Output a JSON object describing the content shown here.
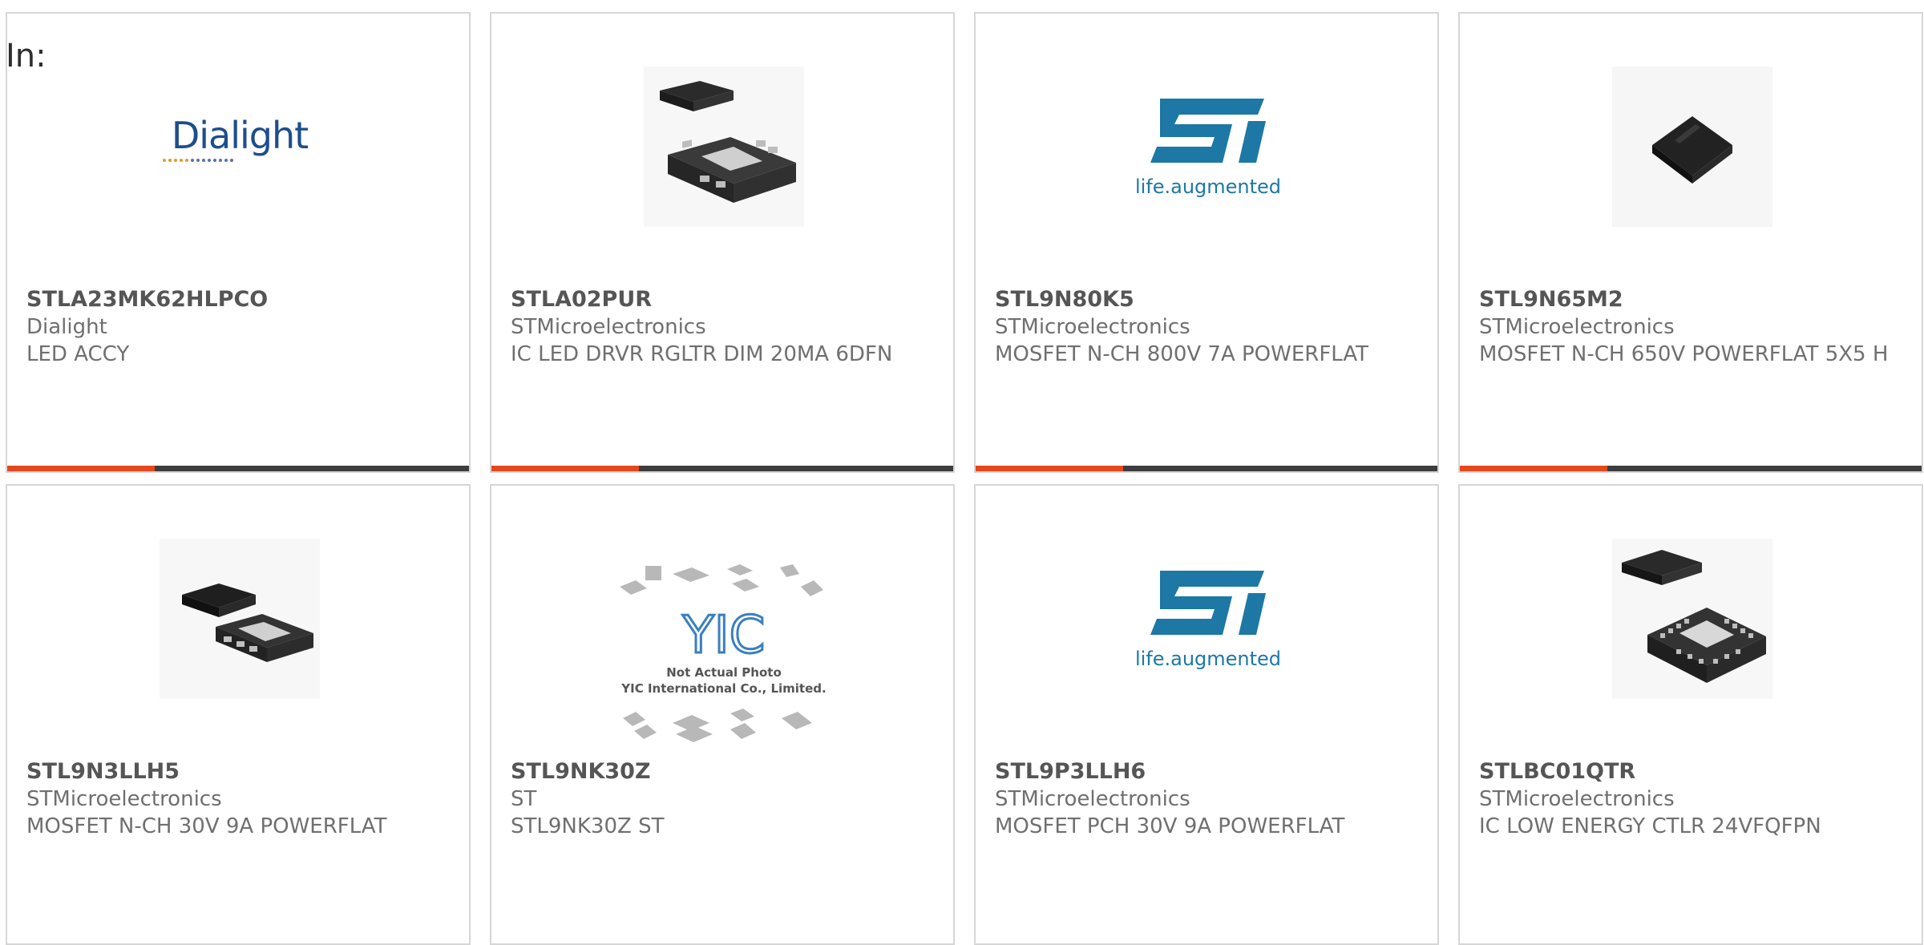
{
  "page": {
    "label": "In:"
  },
  "accent": {
    "bar_fill": "#e5481c",
    "bar_track": "#3d3d3d",
    "st_blue": "#1d78a5",
    "dialight_blue": "#1d4e8d"
  },
  "products": [
    {
      "part_number": "STLA23MK62HLPCO",
      "manufacturer": "Dialight",
      "description": "LED ACCY",
      "image_icon": "dialight-logo-icon",
      "image_text": "Dialight",
      "progress_fraction": 0.32
    },
    {
      "part_number": "STLA02PUR",
      "manufacturer": "STMicroelectronics",
      "description": "IC LED DRVR RGLTR DIM 20MA 6DFN",
      "image_icon": "dfn-package-icon",
      "image_text": "",
      "progress_fraction": 0.32
    },
    {
      "part_number": "STL9N80K5",
      "manufacturer": "STMicroelectronics",
      "description": "MOSFET N-CH 800V 7A POWERFLAT",
      "image_icon": "st-logo-icon",
      "image_text": "life.augmented",
      "progress_fraction": 0.32
    },
    {
      "part_number": "STL9N65M2",
      "manufacturer": "STMicroelectronics",
      "description": "MOSFET N-CH 650V POWERFLAT 5X5 H",
      "image_icon": "powerflat-chip-icon",
      "image_text": "",
      "progress_fraction": 0.32
    },
    {
      "part_number": "STL9N3LLH5",
      "manufacturer": "STMicroelectronics",
      "description": "MOSFET N-CH 30V 9A POWERFLAT",
      "image_icon": "powerflat-package-icon",
      "image_text": ""
    },
    {
      "part_number": "STL9NK30Z",
      "manufacturer": "ST",
      "description": "STL9NK30Z ST",
      "image_icon": "yic-placeholder-icon",
      "image_text": "YIC",
      "image_caption_1": "Not Actual Photo",
      "image_caption_2": "YIC International Co., Limited."
    },
    {
      "part_number": "STL9P3LLH6",
      "manufacturer": "STMicroelectronics",
      "description": "MOSFET PCH 30V 9A POWERFLAT",
      "image_icon": "st-logo-icon",
      "image_text": "life.augmented"
    },
    {
      "part_number": "STLBC01QTR",
      "manufacturer": "STMicroelectronics",
      "description": "IC LOW ENERGY CTLR 24VFQFPN",
      "image_icon": "qfn-package-icon",
      "image_text": ""
    }
  ]
}
